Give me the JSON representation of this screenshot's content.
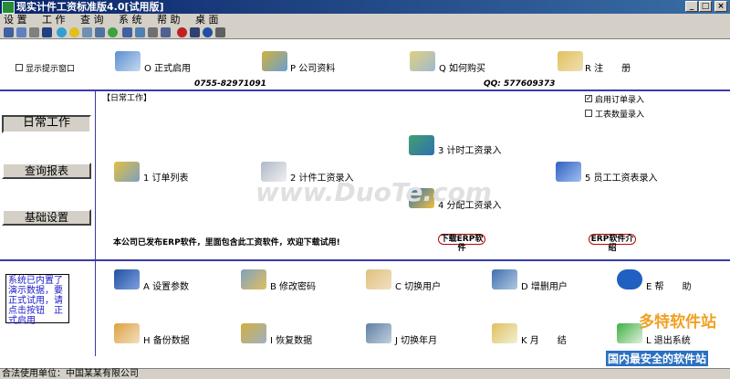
{
  "window": {
    "title": "现实计件工资标准版4.0[试用版]"
  },
  "menu": [
    "设 置",
    "工 作",
    "查 询",
    "系 统",
    "帮 助",
    "桌 面"
  ],
  "toolbar_icons": [
    "grid-icon",
    "list-icon",
    "cut-icon",
    "save-icon",
    "globe-icon",
    "smile-icon",
    "report-icon",
    "table-icon",
    "user-icon",
    "grid2-icon",
    "list2-icon",
    "calc-icon",
    "calendar-icon",
    "stop-icon",
    "mail-icon",
    "help-icon",
    "exit-icon"
  ],
  "top": {
    "show_tip_window": "显示提示窗口",
    "items": [
      {
        "label": "O 正式启用"
      },
      {
        "label": "P 公司资料"
      },
      {
        "label": "Q 如何购买"
      },
      {
        "label": "R 注　　册"
      }
    ],
    "phone": "0755-82971091",
    "qq": "QQ: 577609373"
  },
  "left_nav": {
    "daily_work": "日常工作",
    "query_report": "查询报表",
    "basic_settings": "基础设置"
  },
  "daily": {
    "section_title": "【日常工作】",
    "enable_order_entry": "启用订单录入",
    "work_quantity_entry": "工表数量录入",
    "items": [
      {
        "label": "1 订单列表"
      },
      {
        "label": "2 计件工资录入"
      },
      {
        "label": "3 计时工资录入"
      },
      {
        "label": "4 分配工资录入"
      },
      {
        "label": "5 员工工资表录入"
      }
    ],
    "erp_notice": "本公司已发布ERP软件，里面包含此工资软件，欢迎下载试用!",
    "download_erp": "下载ERP软件",
    "erp_intro": "ERP软件介绍"
  },
  "system": {
    "notice": "系统已内置了演示数据，要正式试用，请点击按钮　正式启用",
    "items": [
      {
        "label": "A 设置参数"
      },
      {
        "label": "B 修改密码"
      },
      {
        "label": "C 切换用户"
      },
      {
        "label": "D 增删用户"
      },
      {
        "label": "E 帮　　助"
      },
      {
        "label": "H 备份数据"
      },
      {
        "label": "I 恢复数据"
      },
      {
        "label": "J 切换年月"
      },
      {
        "label": "K 月　　结"
      },
      {
        "label": "L 退出系统"
      }
    ]
  },
  "status": {
    "text": "合法使用单位：中国某某有限公司"
  },
  "watermarks": {
    "center": "www.DuoTe.com",
    "corner_top": "多特软件站",
    "corner_bottom": "国内最安全的软件站"
  },
  "colors": {
    "accent_line": "#3a3aa8",
    "title_bar": "#0a246a",
    "panel": "#d4d0c8",
    "button_red": "#c00000"
  }
}
